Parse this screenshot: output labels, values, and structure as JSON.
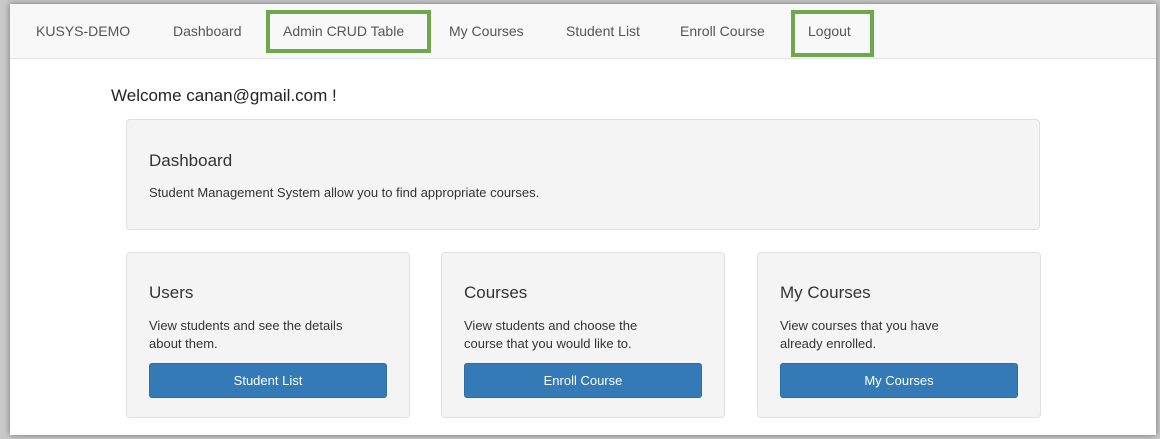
{
  "navbar": {
    "brand": "KUSYS-DEMO",
    "items": [
      {
        "label": "Dashboard"
      },
      {
        "label": "Admin CRUD Table"
      },
      {
        "label": "My Courses"
      },
      {
        "label": "Student List"
      },
      {
        "label": "Enroll Course"
      },
      {
        "label": "Logout"
      }
    ],
    "highlight_color": "#6fa84b"
  },
  "welcome": "Welcome canan@gmail.com !",
  "dashboard": {
    "title": "Dashboard",
    "text": "Student Management System allow you to find appropriate courses."
  },
  "cards": [
    {
      "title": "Users",
      "text": "View students and see the details about them.",
      "button": "Student List"
    },
    {
      "title": "Courses",
      "text": "View students and choose the course that you would like to.",
      "button": "Enroll Course"
    },
    {
      "title": "My Courses",
      "text": "View courses that you have already enrolled.",
      "button": "My Courses"
    }
  ],
  "colors": {
    "primary_button": "#337ab7",
    "panel_bg": "#f4f4f4"
  }
}
